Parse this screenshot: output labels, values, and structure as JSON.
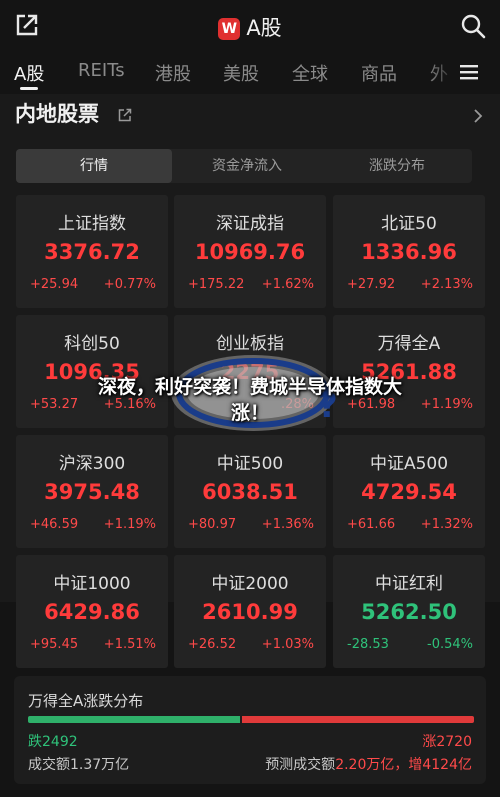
{
  "app": {
    "title": "A股",
    "logo_letter": "W"
  },
  "tabs": [
    "A股",
    "REITs",
    "港股",
    "美股",
    "全球",
    "商品",
    "外"
  ],
  "section": {
    "title": "内地股票"
  },
  "segments": [
    "行情",
    "资金净流入",
    "涨跌分布"
  ],
  "indices": [
    {
      "name": "上证指数",
      "price": "3376.72",
      "chg": "+25.94",
      "pct": "+0.77%",
      "dir": "up"
    },
    {
      "name": "深证成指",
      "price": "10969.76",
      "chg": "+175.22",
      "pct": "+1.62%",
      "dir": "up"
    },
    {
      "name": "北证50",
      "price": "1336.96",
      "chg": "+27.92",
      "pct": "+2.13%",
      "dir": "up"
    },
    {
      "name": "科创50",
      "price": "1096.35",
      "chg": "+53.27",
      "pct": "+5.16%",
      "dir": "up"
    },
    {
      "name": "创业板指",
      "price": "2275",
      "chg": "",
      "pct": ".28%",
      "dir": "up"
    },
    {
      "name": "万得全A",
      "price": "5261.88",
      "chg": "+61.98",
      "pct": "+1.19%",
      "dir": "up"
    },
    {
      "name": "沪深300",
      "price": "3975.48",
      "chg": "+46.59",
      "pct": "+1.19%",
      "dir": "up"
    },
    {
      "name": "中证500",
      "price": "6038.51",
      "chg": "+80.97",
      "pct": "+1.36%",
      "dir": "up"
    },
    {
      "name": "中证A500",
      "price": "4729.54",
      "chg": "+61.66",
      "pct": "+1.32%",
      "dir": "up"
    },
    {
      "name": "中证1000",
      "price": "6429.86",
      "chg": "+95.45",
      "pct": "+1.51%",
      "dir": "up"
    },
    {
      "name": "中证2000",
      "price": "2610.99",
      "chg": "+26.52",
      "pct": "+1.03%",
      "dir": "up"
    },
    {
      "name": "中证红利",
      "price": "5262.50",
      "chg": "-28.53",
      "pct": "-0.54%",
      "dir": "down"
    }
  ],
  "overlay": {
    "line1": "深夜，利好突袭！费城半导体指数大",
    "line2": "涨！"
  },
  "distribution": {
    "title": "万得全A涨跌分布",
    "fall_label": "跌2492",
    "rise_label": "涨2720",
    "fall_count": 2492,
    "rise_count": 2720,
    "turnover": "成交额1.37万亿",
    "forecast_label": "预测成交额",
    "forecast_value": "2.20万亿，增4124亿"
  },
  "colors": {
    "up": "#ff3b3b",
    "down": "#2fc27a",
    "bg": "#141414",
    "card": "#232323"
  }
}
